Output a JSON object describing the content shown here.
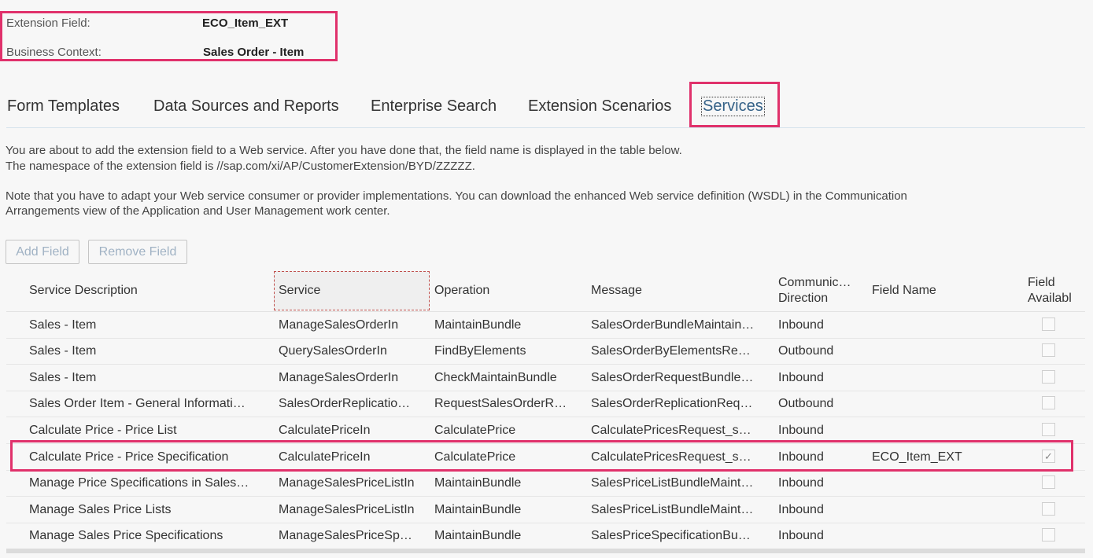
{
  "header": {
    "extension_field_label": "Extension Field:",
    "extension_field_value": "ECO_Item_EXT",
    "business_context_label": "Business Context:",
    "business_context_value": "Sales Order - Item"
  },
  "tabs": [
    {
      "label": "Form Templates"
    },
    {
      "label": "Data Sources and Reports"
    },
    {
      "label": "Enterprise Search"
    },
    {
      "label": "Extension Scenarios"
    },
    {
      "label": "Services",
      "active": true
    }
  ],
  "info": {
    "line1": "You are about to add the extension field to a Web service. After you have done that, the field name is displayed in the table below.",
    "line2": "The namespace of the extension field is //sap.com/xi/AP/CustomerExtension/BYD/ZZZZZ.",
    "line3": "Note that you have to adapt your Web service consumer or provider implementations. You can download the enhanced Web service definition (WSDL) in the Communication",
    "line4": "Arrangements view of the Application and User Management work center."
  },
  "buttons": {
    "add_field": "Add Field",
    "remove_field": "Remove Field"
  },
  "table": {
    "columns": {
      "service_description": "Service Description",
      "service": "Service",
      "operation": "Operation",
      "message": "Message",
      "direction_line1": "Communic…",
      "direction_line2": "Direction",
      "field_name": "Field Name",
      "available_line1": "Field",
      "available_line2": "Availabl"
    },
    "rows": [
      {
        "desc": "Sales - Item",
        "service": "ManageSalesOrderIn",
        "operation": "MaintainBundle",
        "message": "SalesOrderBundleMaintain…",
        "direction": "Inbound",
        "field": "",
        "available": false
      },
      {
        "desc": "Sales - Item",
        "service": "QuerySalesOrderIn",
        "operation": "FindByElements",
        "message": "SalesOrderByElementsRe…",
        "direction": "Outbound",
        "field": "",
        "available": false
      },
      {
        "desc": "Sales - Item",
        "service": "ManageSalesOrderIn",
        "operation": "CheckMaintainBundle",
        "message": "SalesOrderRequestBundle…",
        "direction": "Inbound",
        "field": "",
        "available": false
      },
      {
        "desc": "Sales Order Item - General Informati…",
        "service": "SalesOrderReplicatio…",
        "operation": "RequestSalesOrderR…",
        "message": "SalesOrderReplicationReq…",
        "direction": "Outbound",
        "field": "",
        "available": false
      },
      {
        "desc": "Calculate Price - Price List",
        "service": "CalculatePriceIn",
        "operation": "CalculatePrice",
        "message": "CalculatePricesRequest_s…",
        "direction": "Inbound",
        "field": "",
        "available": false
      },
      {
        "desc": "Calculate Price - Price Specification",
        "service": "CalculatePriceIn",
        "operation": "CalculatePrice",
        "message": "CalculatePricesRequest_s…",
        "direction": "Inbound",
        "field": "ECO_Item_EXT",
        "available": true
      },
      {
        "desc": "Manage Price Specifications in Sales…",
        "service": "ManageSalesPriceListIn",
        "operation": "MaintainBundle",
        "message": "SalesPriceListBundleMaint…",
        "direction": "Inbound",
        "field": "",
        "available": false
      },
      {
        "desc": "Manage Sales Price Lists",
        "service": "ManageSalesPriceListIn",
        "operation": "MaintainBundle",
        "message": "SalesPriceListBundleMaint…",
        "direction": "Inbound",
        "field": "",
        "available": false
      },
      {
        "desc": "Manage Sales Price Specifications",
        "service": "ManageSalesPriceSp…",
        "operation": "MaintainBundle",
        "message": "SalesPriceSpecificationBu…",
        "direction": "Inbound",
        "field": "",
        "available": false
      }
    ]
  },
  "colors": {
    "highlight": "#e0316b",
    "active_tab": "#346187",
    "disabled_button_text": "#a0b2c4"
  },
  "icons": {
    "checkbox_checked": "checkmark-icon"
  }
}
